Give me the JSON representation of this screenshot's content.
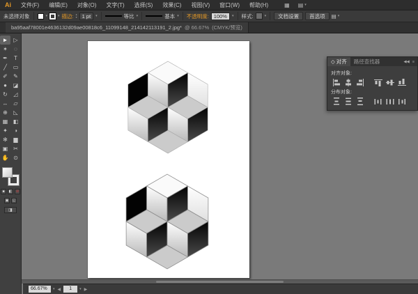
{
  "colors": {
    "accent_orange": "#e39827",
    "bar_bg": "#2d2d2d",
    "controlbar_bg": "#3a3a3a",
    "toolbar_bg": "#404040",
    "panel_bg": "#3e3e3e",
    "canvas_bg": "#7a7a7a",
    "artboard_bg": "#ffffff",
    "face_white_top": "#ffffff",
    "face_white_bottom": "#b9b9b9",
    "face_black_top": "#030303",
    "face_black_bottom": "#4a4a4a",
    "face_gray": "#cbcbcb",
    "face_top": "#fafafa"
  },
  "icons": {
    "dropdown": "▾",
    "spin_up": "▴",
    "spin_down": "▾",
    "collapse": "◀◀",
    "panel_menu": "≡",
    "tab_diamond": "◇",
    "arrange_documents": "▦",
    "workspace": "▤",
    "prev": "◀",
    "next": "▶"
  },
  "menubar": {
    "logo": "Ai",
    "items": [
      "文件(F)",
      "编辑(E)",
      "对象(O)",
      "文字(T)",
      "选择(S)",
      "效果(C)",
      "视图(V)",
      "窗口(W)",
      "帮助(H)"
    ]
  },
  "controlbar": {
    "no_selection": "未选择对象",
    "stroke_label": "描边:",
    "stroke_value": "1 pt",
    "profile_value": "等比",
    "brush_value": "基本",
    "opacity_label": "不透明度:",
    "opacity_value": "100%",
    "style_label": "样式:",
    "doc_setup_btn": "文档设置",
    "preferences_btn": "首选项"
  },
  "doc_tab": {
    "filename": "ba95aaf78001e4636132d09ae00818c6_11099148_214142113191_2.jpg*",
    "zoom_display": "@ 66.67%",
    "mode_display": "(CMYK/预览)"
  },
  "toolbar": {
    "tools": [
      "►",
      "▷",
      "✶",
      "◌",
      "✒",
      "T",
      "╱",
      "▭",
      "✐",
      "✎",
      "●",
      "◪",
      "↻",
      "◿",
      "↔",
      "▱",
      "⊕",
      "◺",
      "▦",
      "◧",
      "✦",
      "◑",
      "✻",
      "▆",
      "▣",
      "✂",
      "✋",
      "⊙"
    ]
  },
  "panel": {
    "tabs": [
      "对齐",
      "路径查找器"
    ],
    "align_objects_label": "对齐对象:",
    "distribute_objects_label": "分布对象:"
  },
  "statusbar": {
    "zoom_value": "66.67%",
    "artboard_value": "1"
  },
  "artwork": {
    "patterns": 2,
    "description": "isometric cube hexagon illusion, black/white/gray rhombus faces"
  }
}
